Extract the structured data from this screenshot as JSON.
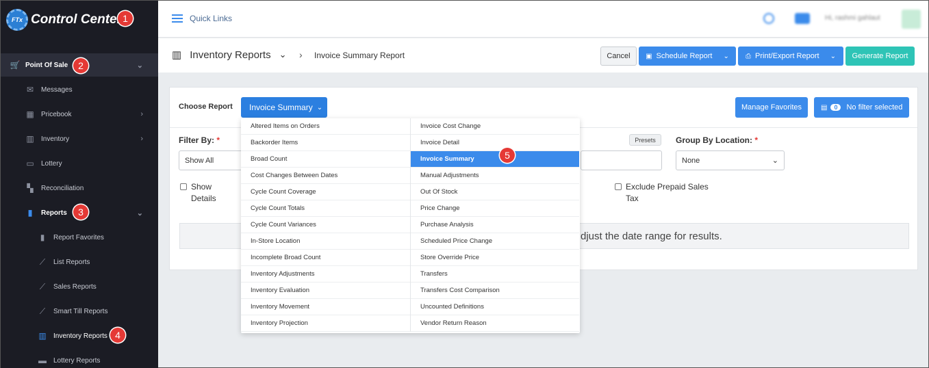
{
  "app": {
    "logo_badge": "FTx",
    "title": "Control Center"
  },
  "callouts": [
    "1",
    "2",
    "3",
    "4",
    "5"
  ],
  "sidebar": {
    "point_of_sale": "Point Of Sale",
    "items": [
      {
        "label": "Messages",
        "icon": "envelope-icon"
      },
      {
        "label": "Pricebook",
        "icon": "calculator-icon"
      },
      {
        "label": "Inventory",
        "icon": "factory-icon"
      },
      {
        "label": "Lottery",
        "icon": "ticket-icon"
      },
      {
        "label": "Reconciliation",
        "icon": "grid-icon"
      },
      {
        "label": "Reports",
        "icon": "bar-chart-icon"
      }
    ],
    "sub_items": [
      {
        "label": "Report Favorites",
        "icon": "bookmark-icon"
      },
      {
        "label": "List Reports",
        "icon": "line-chart-icon"
      },
      {
        "label": "Sales Reports",
        "icon": "line-chart-icon"
      },
      {
        "label": "Smart Till Reports",
        "icon": "line-chart-icon"
      },
      {
        "label": "Inventory Reports",
        "icon": "factory-icon"
      },
      {
        "label": "Lottery Reports",
        "icon": "ticket-icon"
      }
    ]
  },
  "topbar": {
    "quick_links": "Quick Links",
    "user": "Hi, rashmi gahlaut"
  },
  "header": {
    "section": "Inventory Reports",
    "crumb": "Invoice Summary Report"
  },
  "buttons": {
    "cancel": "Cancel",
    "schedule": "Schedule Report",
    "print": "Print/Export Report",
    "generate": "Generate Report",
    "manage_fav": "Manage Favorites",
    "no_filter": "No filter selected",
    "filter_count": "0",
    "presets": "Presets",
    "choose_report": "Invoice Summary"
  },
  "form": {
    "choose_report_label": "Choose Report",
    "filter_by_label": "Filter By:",
    "required": "*",
    "filter_value": "Show All",
    "group_by_label": "Group By Location:",
    "group_by_value": "None",
    "show_details_1": "Show",
    "show_details_2": "Details",
    "exclude_1": "Exclude Prepaid Sales",
    "exclude_2": "Tax",
    "message": "djust the date range for results."
  },
  "dropdown": {
    "left": [
      "Altered Items on Orders",
      "Backorder Items",
      "Broad Count",
      "Cost Changes Between Dates",
      "Cycle Count Coverage",
      "Cycle Count Totals",
      "Cycle Count Variances",
      "In-Store Location",
      "Incomplete Broad Count",
      "Inventory Adjustments",
      "Inventory Evaluation",
      "Inventory Movement",
      "Inventory Projection"
    ],
    "right": [
      "Invoice Cost Change",
      "Invoice Detail",
      "Invoice Summary",
      "Manual Adjustments",
      "Out Of Stock",
      "Price Change",
      "Purchase Analysis",
      "Scheduled Price Change",
      "Store Override Price",
      "Transfers",
      "Transfers Cost Comparison",
      "Uncounted Definitions",
      "Vendor Return Reason"
    ],
    "selected": "Invoice Summary"
  },
  "colors": {
    "accent": "#3b8beb",
    "teal": "#2ec4b6",
    "sidebar": "#1b1c24",
    "callout": "#e53935"
  }
}
